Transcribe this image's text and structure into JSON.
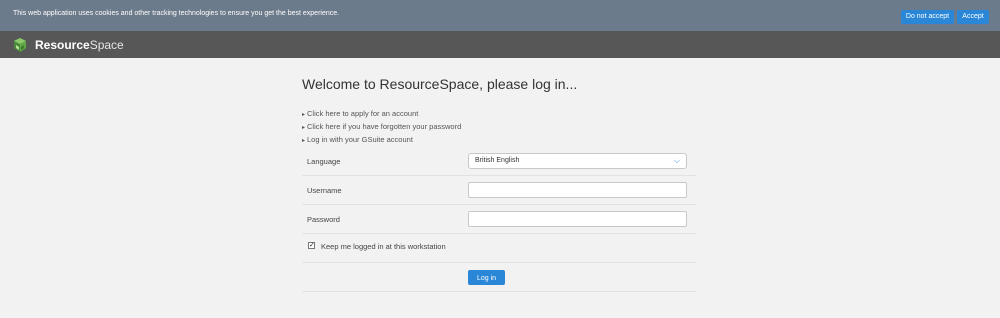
{
  "cookie_banner": {
    "message": "This web application uses cookies and other tracking technologies to ensure you get the best experience.",
    "decline_label": "Do not accept",
    "accept_label": "Accept"
  },
  "header": {
    "logo_bold": "Resource",
    "logo_light": "Space",
    "logo_icon": "resourcespace-cube-icon"
  },
  "login": {
    "title": "Welcome to ResourceSpace, please log in...",
    "links": [
      "Click here to apply for an account",
      "Click here if you have forgotten your password",
      "Log in with your GSuite account"
    ],
    "language_label": "Language",
    "language_value": "British English",
    "username_label": "Username",
    "username_value": "",
    "password_label": "Password",
    "password_value": "",
    "keep_logged_in_label": "Keep me logged in at this workstation",
    "keep_logged_in_checked": true,
    "login_button": "Log in"
  },
  "colors": {
    "cookie_bar": "#6c7b8b",
    "header": "#575757",
    "accent": "#2a87d8",
    "background": "#f2f2f2"
  }
}
